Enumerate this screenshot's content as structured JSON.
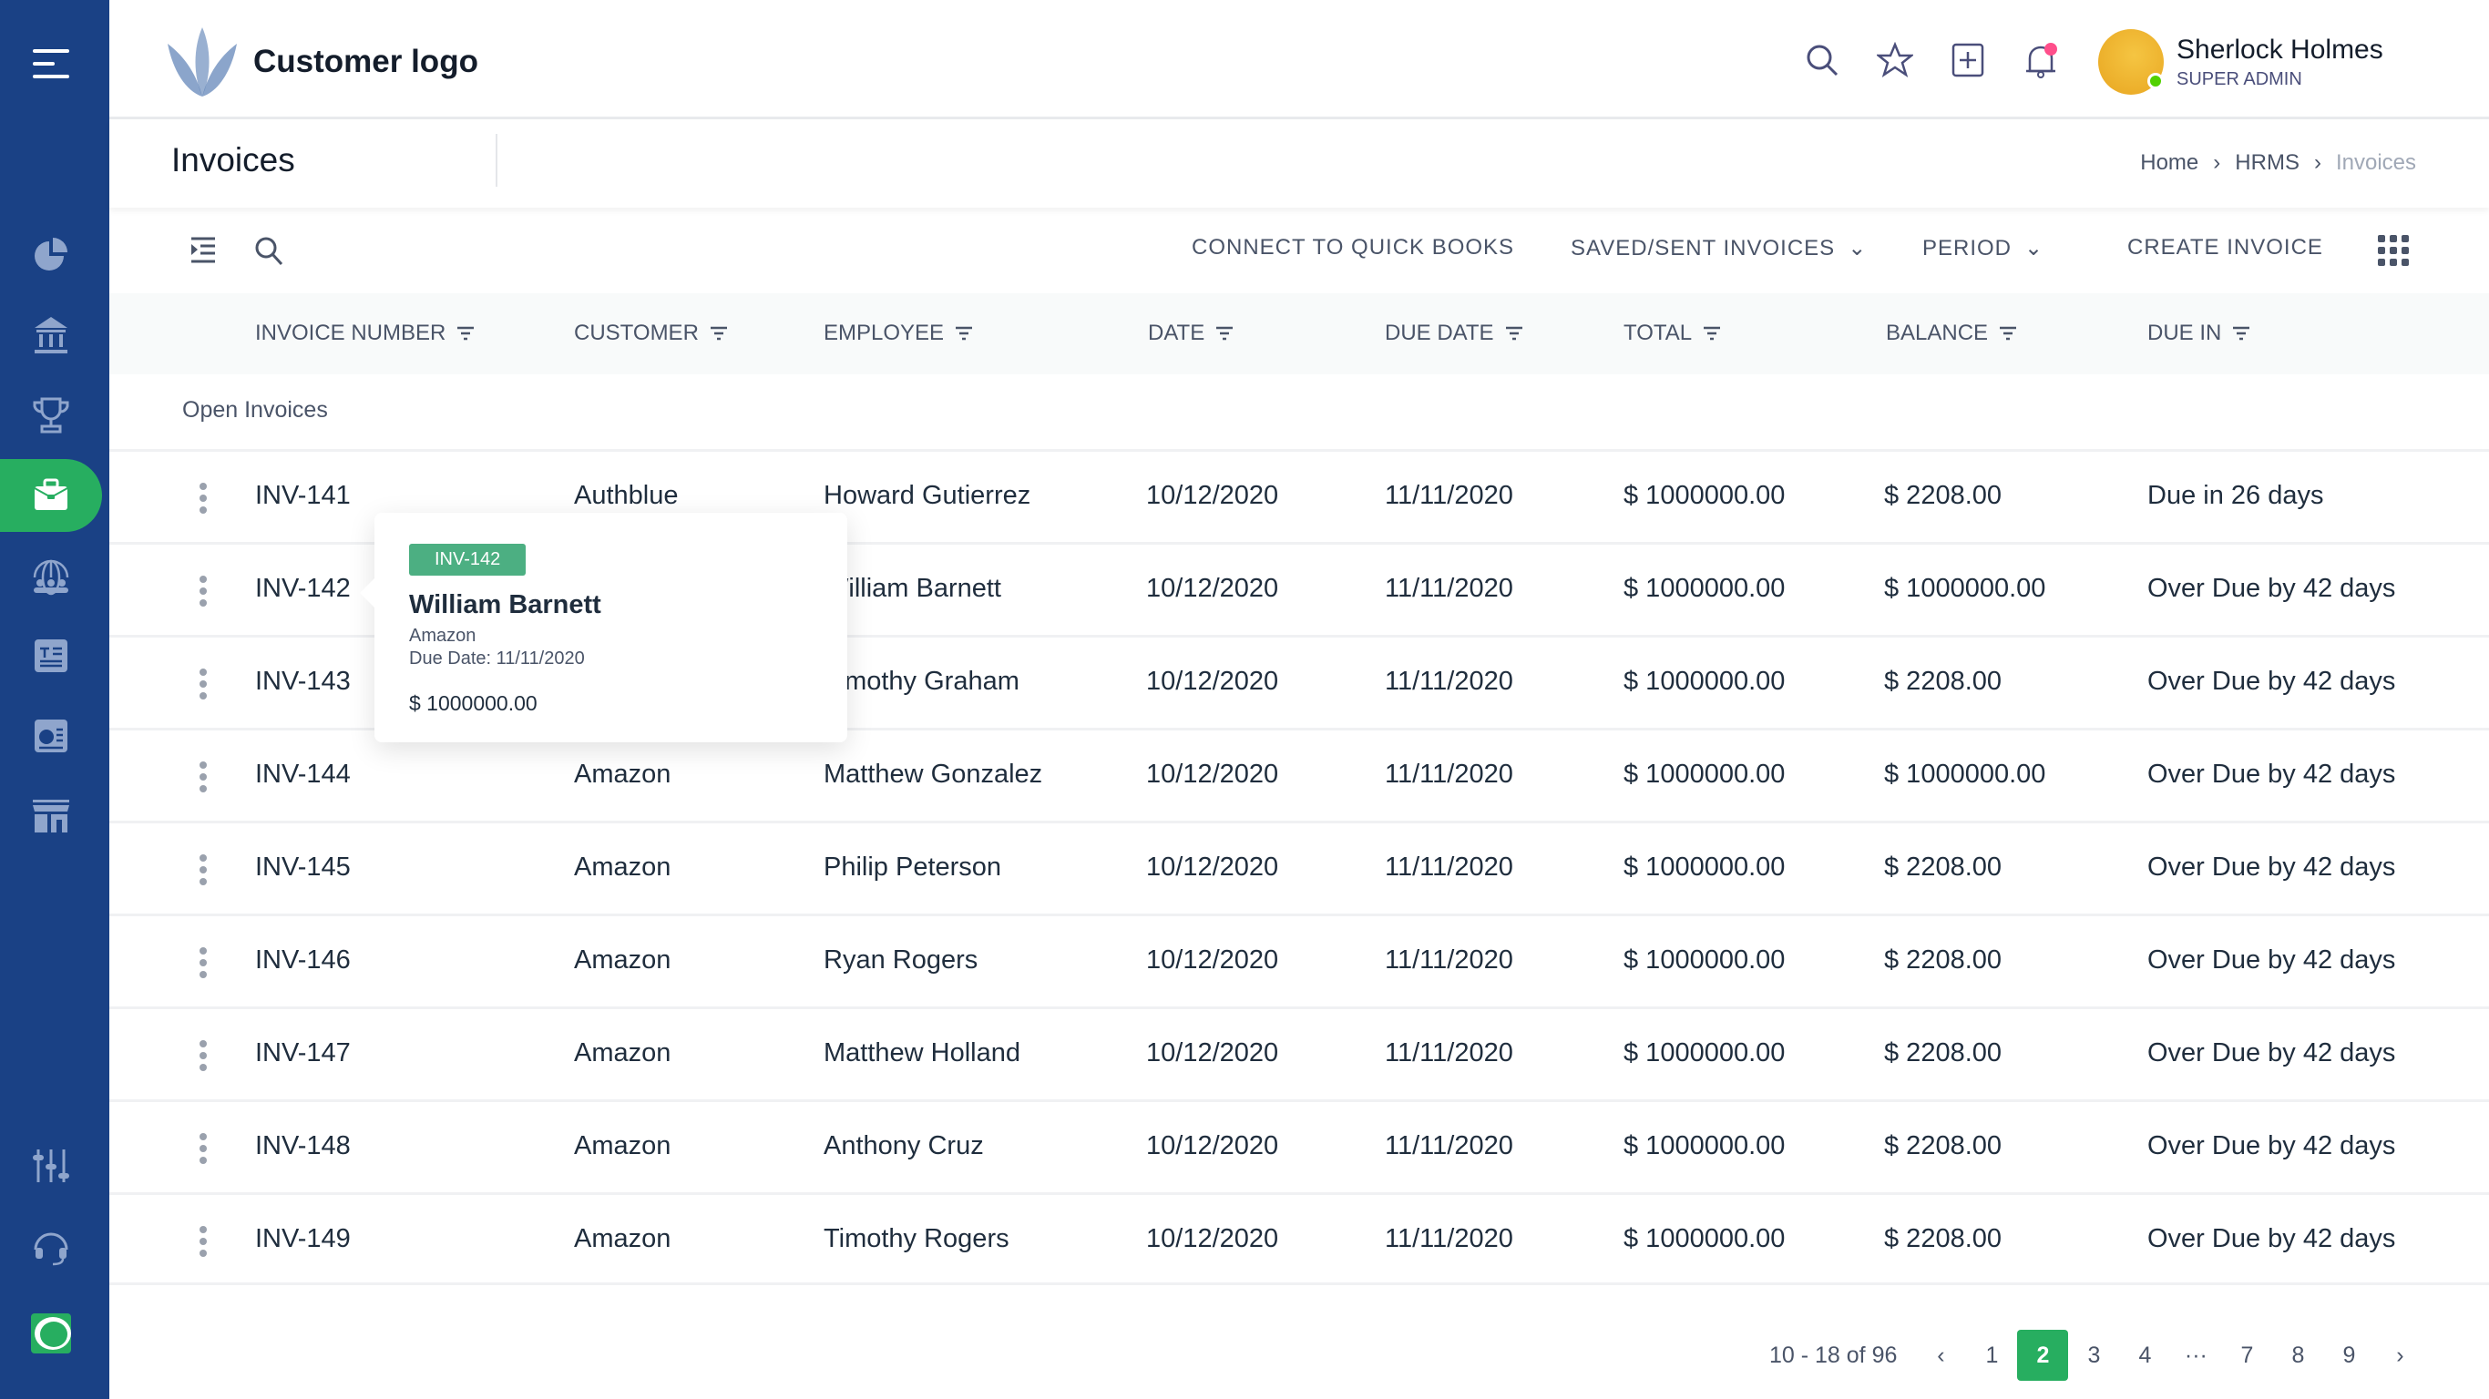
{
  "colors": {
    "sidebar": "#1a4185",
    "accent": "#27ae60",
    "badge": "#4caf82",
    "notification": "#ff4f8b"
  },
  "sidebar": {
    "items": [
      {
        "icon": "menu-icon"
      },
      {
        "icon": "pie-chart-icon"
      },
      {
        "icon": "bank-icon"
      },
      {
        "icon": "trophy-icon"
      },
      {
        "icon": "briefcase-icon",
        "active": true
      },
      {
        "icon": "global-team-icon"
      },
      {
        "icon": "news-icon"
      },
      {
        "icon": "report-icon"
      },
      {
        "icon": "store-icon"
      },
      {
        "icon": "sliders-icon"
      },
      {
        "icon": "headset-icon"
      },
      {
        "icon": "app-logo-icon"
      }
    ]
  },
  "header": {
    "logo_text": "Customer logo",
    "user": {
      "name": "Sherlock Holmes",
      "role": "SUPER ADMIN",
      "status": "online"
    },
    "icons": [
      "search-icon",
      "star-icon",
      "add-icon",
      "bell-icon"
    ]
  },
  "page": {
    "title": "Invoices",
    "breadcrumb": [
      "Home",
      "HRMS",
      "Invoices"
    ]
  },
  "toolbar": {
    "connect": "CONNECT TO QUICK BOOKS",
    "saved": "SAVED/SENT INVOICES",
    "period": "PERIOD",
    "create": "CREATE INVOICE"
  },
  "table": {
    "columns": [
      "INVOICE NUMBER",
      "CUSTOMER",
      "EMPLOYEE",
      "DATE",
      "DUE DATE",
      "TOTAL",
      "BALANCE",
      "DUE IN"
    ],
    "group": "Open Invoices",
    "rows": [
      [
        "INV-141",
        "Authblue",
        "Howard Gutierrez",
        "10/12/2020",
        "11/11/2020",
        "$ 1000000.00",
        "$ 2208.00",
        "Due in 26 days"
      ],
      [
        "INV-142",
        "Amazon",
        "William Barnett",
        "10/12/2020",
        "11/11/2020",
        "$ 1000000.00",
        "$ 1000000.00",
        "Over Due by 42 days"
      ],
      [
        "INV-143",
        "",
        "Timothy Graham",
        "10/12/2020",
        "11/11/2020",
        "$ 1000000.00",
        "$ 2208.00",
        "Over Due by 42 days"
      ],
      [
        "INV-144",
        "Amazon",
        "Matthew Gonzalez",
        "10/12/2020",
        "11/11/2020",
        "$ 1000000.00",
        "$ 1000000.00",
        "Over Due by 42 days"
      ],
      [
        "INV-145",
        "Amazon",
        "Philip Peterson",
        "10/12/2020",
        "11/11/2020",
        "$ 1000000.00",
        "$ 2208.00",
        "Over Due by 42 days"
      ],
      [
        "INV-146",
        "Amazon",
        "Ryan Rogers",
        "10/12/2020",
        "11/11/2020",
        "$ 1000000.00",
        "$ 2208.00",
        "Over Due by 42 days"
      ],
      [
        "INV-147",
        "Amazon",
        "Matthew Holland",
        "10/12/2020",
        "11/11/2020",
        "$ 1000000.00",
        "$ 2208.00",
        "Over Due by 42 days"
      ],
      [
        "INV-148",
        "Amazon",
        "Anthony Cruz",
        "10/12/2020",
        "11/11/2020",
        "$ 1000000.00",
        "$ 2208.00",
        "Over Due by 42 days"
      ],
      [
        "INV-149",
        "Amazon",
        "Timothy Rogers",
        "10/12/2020",
        "11/11/2020",
        "$ 1000000.00",
        "$ 2208.00",
        "Over Due by 42 days"
      ]
    ]
  },
  "tooltip": {
    "badge": "INV-142",
    "name": "William Barnett",
    "customer": "Amazon",
    "due": "Due Date: 11/11/2020",
    "total": "$ 1000000.00"
  },
  "pagination": {
    "range": "10 - 18 of 96",
    "pages": [
      "1",
      "2",
      "3",
      "4",
      "···",
      "7",
      "8",
      "9"
    ],
    "current": "2"
  }
}
